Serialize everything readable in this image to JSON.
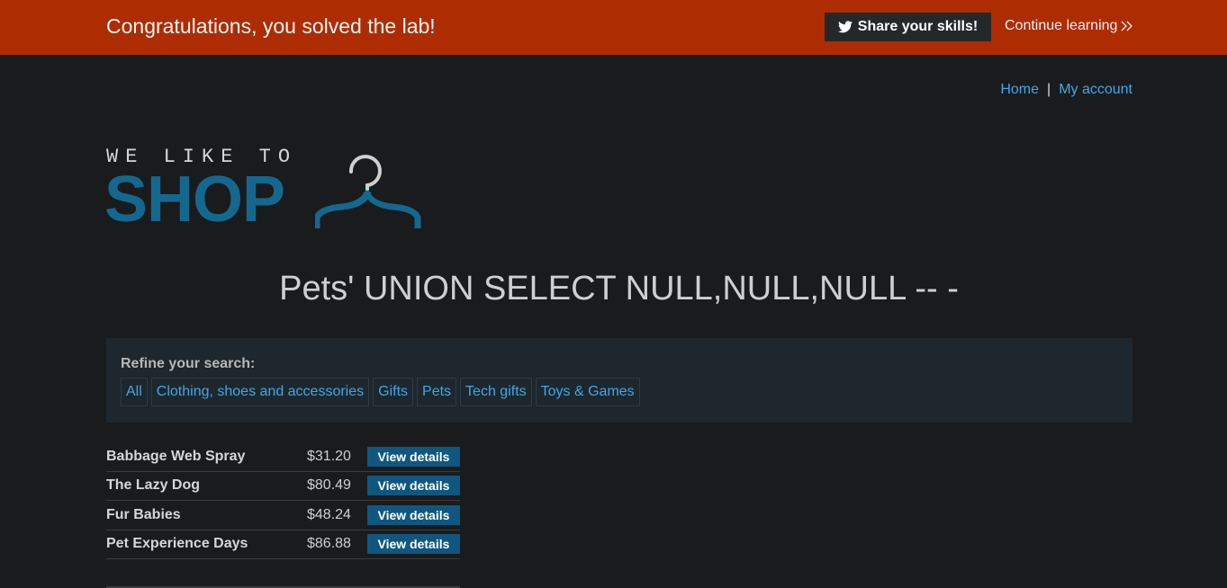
{
  "banner": {
    "message": "Congratulations, you solved the lab!",
    "share_label": "Share your skills!",
    "continue_label": "Continue learning"
  },
  "nav": {
    "home": "Home",
    "separator": "|",
    "account": "My account"
  },
  "logo": {
    "top_text": "WE LIKE TO",
    "main_text": "SHOP"
  },
  "heading": "Pets' UNION SELECT NULL,NULL,NULL -- -",
  "refine": {
    "label": "Refine your search:",
    "filters": [
      "All",
      "Clothing, shoes and accessories",
      "Gifts",
      "Pets",
      "Tech gifts",
      "Toys & Games"
    ]
  },
  "products": [
    {
      "name": "Babbage Web Spray",
      "price": "$31.20",
      "button": "View details"
    },
    {
      "name": "The Lazy Dog",
      "price": "$80.49",
      "button": "View details"
    },
    {
      "name": "Fur Babies",
      "price": "$48.24",
      "button": "View details"
    },
    {
      "name": "Pet Experience Days",
      "price": "$86.88",
      "button": "View details"
    }
  ],
  "colors": {
    "banner": "#ae2c02",
    "background": "#1a1b1d",
    "link": "#3ea8ea",
    "brand": "#14688f",
    "button": "#0f5780"
  },
  "icons": {
    "share": "twitter-bird-icon",
    "continue": "double-chevron-right-icon",
    "logo": "hanger-icon"
  }
}
